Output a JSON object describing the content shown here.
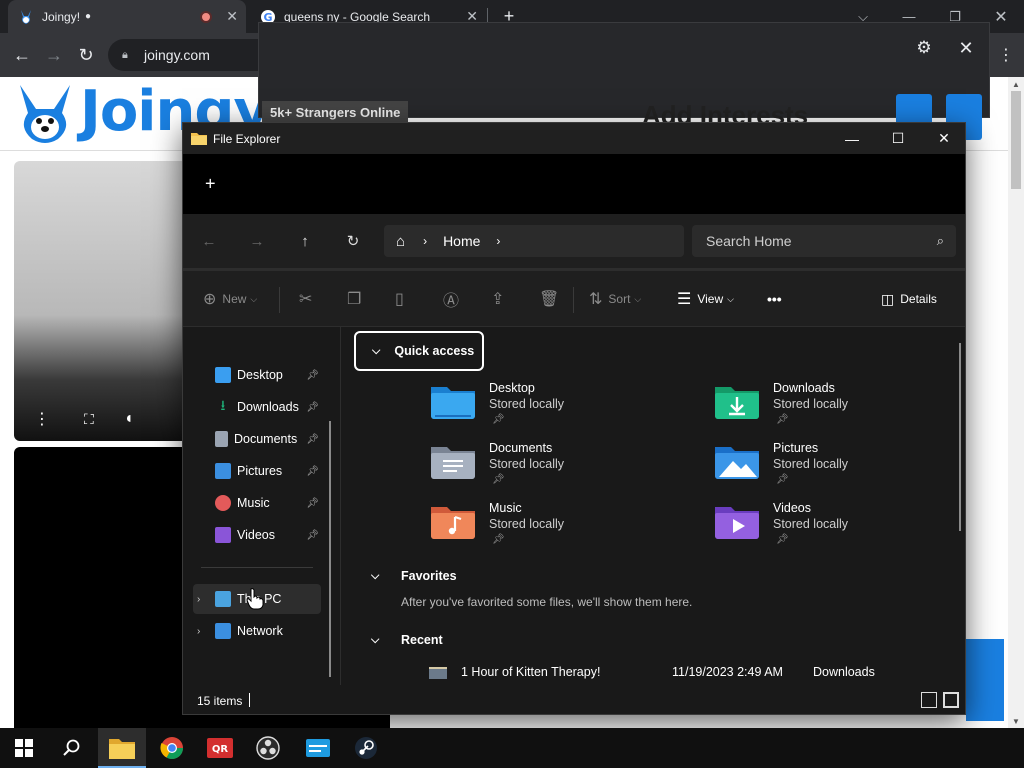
{
  "browser": {
    "tabs": [
      {
        "title": "Joingy!",
        "icon": "joingy-bunny-icon"
      },
      {
        "title": "queens ny - Google Search",
        "icon": "google-icon"
      }
    ],
    "address": "joingy.com",
    "new_tab": "+"
  },
  "joingy": {
    "logo_text": "Joingy",
    "strangers_badge": "5k+ Strangers Online",
    "add_interests": "Add Interests",
    "brand_color": "#1a7fe0"
  },
  "explorer": {
    "title": "File Explorer",
    "breadcrumb": "Home",
    "search_placeholder": "Search Home",
    "commands": {
      "new": "New",
      "sort": "Sort",
      "view": "View",
      "more": "•••",
      "details": "Details"
    },
    "sidebar": {
      "quick": [
        {
          "label": "Desktop",
          "color": "#3a9ef0"
        },
        {
          "label": "Downloads",
          "color": "#1eb37a"
        },
        {
          "label": "Documents",
          "color": "#9aa4b2"
        },
        {
          "label": "Pictures",
          "color": "#3b8fe0"
        },
        {
          "label": "Music",
          "color": "#e35a5a"
        },
        {
          "label": "Videos",
          "color": "#8a55d8"
        }
      ],
      "this_pc": "This PC",
      "network": "Network"
    },
    "quick_access_label": "Quick access",
    "folders": [
      {
        "name": "Desktop",
        "status": "Stored locally"
      },
      {
        "name": "Downloads",
        "status": "Stored locally"
      },
      {
        "name": "Documents",
        "status": "Stored locally"
      },
      {
        "name": "Pictures",
        "status": "Stored locally"
      },
      {
        "name": "Music",
        "status": "Stored locally"
      },
      {
        "name": "Videos",
        "status": "Stored locally"
      }
    ],
    "favorites_label": "Favorites",
    "favorites_empty": "After you've favorited some files, we'll show them here.",
    "recent_label": "Recent",
    "recent": [
      {
        "name": "1 Hour of Kitten Therapy!",
        "date": "11/19/2023 2:49 AM",
        "location": "Downloads"
      }
    ],
    "status_count": "15 items"
  }
}
